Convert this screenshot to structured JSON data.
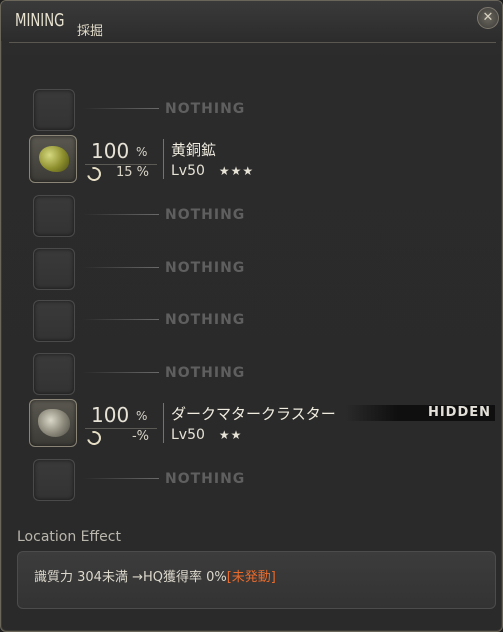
{
  "window": {
    "title_en": "MINING",
    "title_jp": "採掘",
    "close_icon": "crossed-tools-close-icon"
  },
  "rows": [
    {
      "empty": true,
      "label": "NOTHING"
    },
    {
      "empty": false,
      "success_pct": "100",
      "pct_sign": "%",
      "hq_pct": "15",
      "hq_sign": "%",
      "name": "黄銅鉱",
      "level": "Lv50",
      "stars": "★★★",
      "icon": "yellow-ore-icon"
    },
    {
      "empty": true,
      "label": "NOTHING"
    },
    {
      "empty": true,
      "label": "NOTHING"
    },
    {
      "empty": true,
      "label": "NOTHING"
    },
    {
      "empty": true,
      "label": "NOTHING"
    },
    {
      "empty": false,
      "success_pct": "100",
      "pct_sign": "%",
      "hq_pct": "-",
      "hq_sign": "%",
      "name": "ダークマタークラスター",
      "level": "Lv50",
      "stars": "★★",
      "tag": "HIDDEN",
      "icon": "dark-matter-cluster-icon"
    },
    {
      "empty": true,
      "label": "NOTHING"
    }
  ],
  "location_effect": {
    "label": "Location Effect",
    "text": "識質力 304未満 →HQ獲得率 0%",
    "status": "[未発動]"
  },
  "colors": {
    "status_orange": "#e86a2c",
    "nothing_gray": "#5f5f5f",
    "border_gold": "#6b665a"
  }
}
